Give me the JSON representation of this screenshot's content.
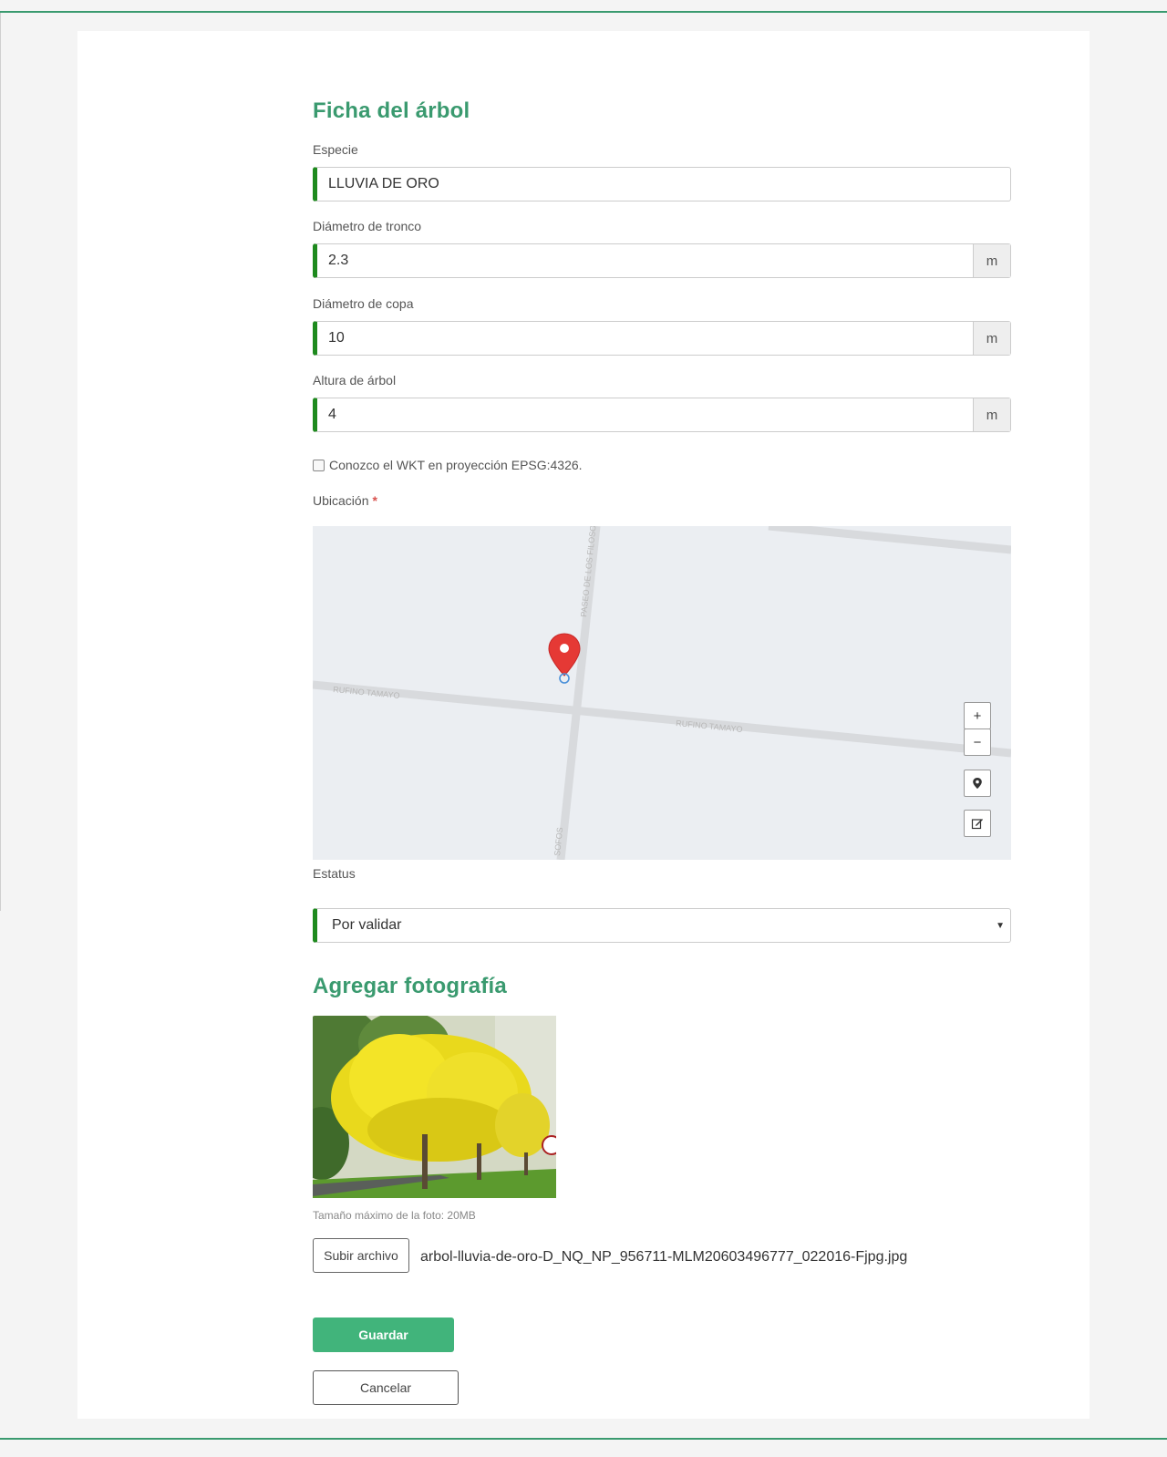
{
  "tree_form": {
    "title": "Ficha del árbol",
    "species": {
      "label": "Especie",
      "value": "LLUVIA DE ORO"
    },
    "trunk_diameter": {
      "label": "Diámetro de tronco",
      "value": "2.3",
      "unit": "m"
    },
    "crown_diameter": {
      "label": "Diámetro de copa",
      "value": "10",
      "unit": "m"
    },
    "tree_height": {
      "label": "Altura de árbol",
      "value": "4",
      "unit": "m"
    },
    "wkt_checkbox": {
      "label": "Conozco el WKT en proyección EPSG:4326.",
      "checked": false
    },
    "location": {
      "label": "Ubicación",
      "required_mark": "*",
      "map": {
        "street_labels": [
          "RUFINO TAMAYO",
          "RUFINO TAMAYO",
          "PASEO DE LOS FILOSO",
          "SOFOS"
        ],
        "controls": {
          "zoom_in": "+",
          "zoom_out": "−"
        },
        "icons": [
          "map-marker-icon",
          "marker-tool-icon",
          "edit-tool-icon"
        ]
      }
    },
    "status": {
      "label": "Estatus",
      "selected": "Por validar"
    }
  },
  "photo_section": {
    "title": "Agregar fotografía",
    "hint": "Tamaño máximo de la foto: 20MB",
    "upload_label": "Subir archivo",
    "file_name": "arbol-lluvia-de-oro-D_NQ_NP_956711-MLM20603496777_022016-Fjpg.jpg"
  },
  "actions": {
    "save": "Guardar",
    "cancel": "Cancelar"
  },
  "colors": {
    "accent": "#3a9a6f",
    "field_marker": "#1e8a1e",
    "save_button": "#41b47b",
    "required": "#d9534f"
  }
}
